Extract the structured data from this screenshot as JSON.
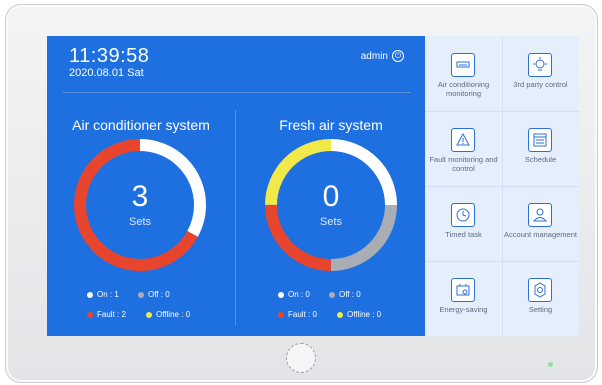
{
  "header": {
    "time": "11:39:58",
    "date": "2020.08.01   Sat",
    "user": "admin"
  },
  "systems": [
    {
      "title": "Air conditioner system",
      "count": "3",
      "unit": "Sets",
      "legend": {
        "on": "On : 1",
        "off": "Off : 0",
        "fault": "Fault : 2",
        "offline": "Offline : 0"
      },
      "segments": [
        {
          "status": "on",
          "fraction": 0.33,
          "color": "#ffffff"
        },
        {
          "status": "fault",
          "fraction": 0.67,
          "color": "#e8452e"
        }
      ]
    },
    {
      "title": "Fresh air system",
      "count": "0",
      "unit": "Sets",
      "legend": {
        "on": "On : 0",
        "off": "Off : 0",
        "fault": "Fault : 0",
        "offline": "Offline : 0"
      },
      "segments": [
        {
          "status": "on",
          "fraction": 0.25,
          "color": "#ffffff"
        },
        {
          "status": "off",
          "fraction": 0.25,
          "color": "#a9adb4"
        },
        {
          "status": "fault",
          "fraction": 0.25,
          "color": "#e8452e"
        },
        {
          "status": "offline",
          "fraction": 0.25,
          "color": "#f1e84a"
        }
      ]
    }
  ],
  "status_colors": {
    "on": "#ffffff",
    "off": "#a9adb4",
    "fault": "#e8452e",
    "offline": "#f1e84a"
  },
  "menu": [
    {
      "label": "Air conditioning monitoring",
      "icon": "ac-unit-icon"
    },
    {
      "label": "3rd party control",
      "icon": "bulb-icon"
    },
    {
      "label": "Fault monitoring and control",
      "icon": "warning-icon"
    },
    {
      "label": "Schedule",
      "icon": "calendar-icon"
    },
    {
      "label": "Timed task",
      "icon": "clock-icon"
    },
    {
      "label": "Account management",
      "icon": "user-icon"
    },
    {
      "label": "Energy-saving",
      "icon": "battery-leaf-icon"
    },
    {
      "label": "Setting",
      "icon": "gear-icon"
    }
  ]
}
